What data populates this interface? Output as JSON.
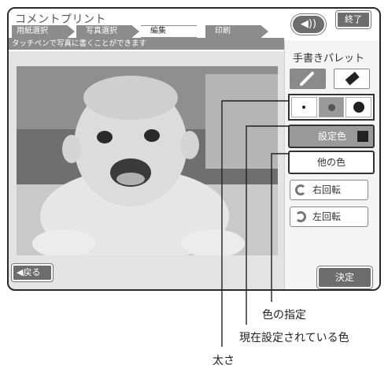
{
  "header": {
    "title": "コメントプリント",
    "steps": [
      "用紙選択",
      "写真選択",
      "編集",
      "印刷"
    ],
    "active_step": "編集",
    "instruction": "タッチペンで写真に書くことができます",
    "sound_icon": "speaker-icon",
    "end_label": "終了"
  },
  "photo": {
    "description_icon": "photo"
  },
  "palette": {
    "title": "手書きパレット",
    "tools": [
      "pen-icon",
      "eraser-icon"
    ],
    "sizes": [
      "small",
      "medium",
      "large"
    ],
    "selected_size": "medium",
    "set_color_label": "設定色",
    "current_color": "#222222",
    "other_color_label": "他の色",
    "rotate_right_label": "右回転",
    "rotate_left_label": "左回転",
    "confirm_label": "決定"
  },
  "footer": {
    "back_label": "◀戻る"
  },
  "callouts": {
    "color_spec": "色の指定",
    "current_color": "現在設定されている色",
    "thickness": "太さ"
  }
}
